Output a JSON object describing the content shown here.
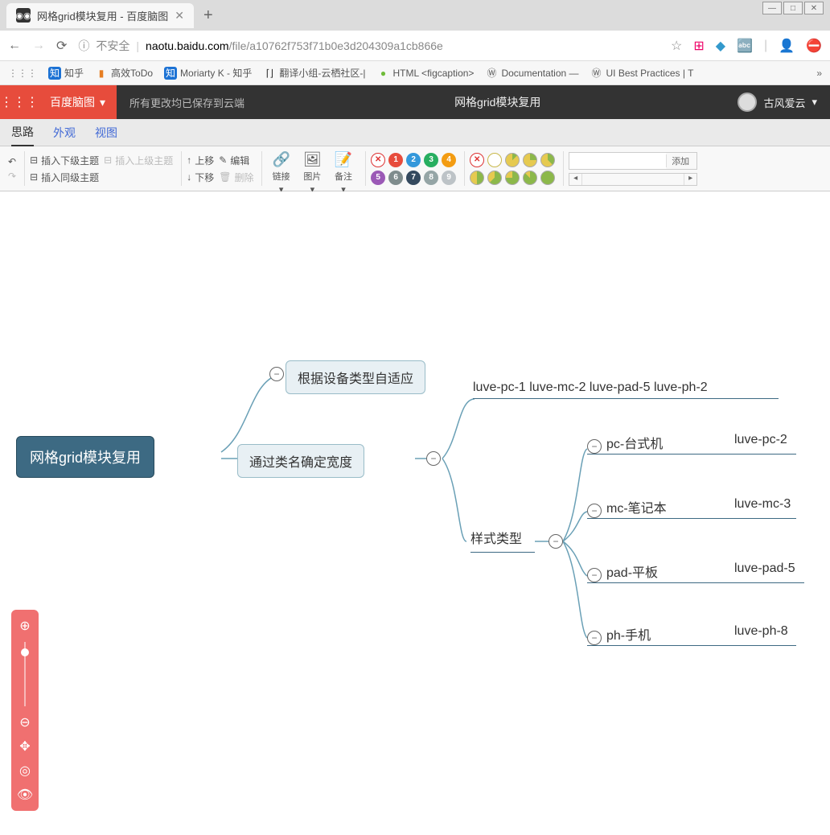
{
  "browser": {
    "tab_title": "网格grid模块复用 - 百度脑图",
    "url_insecure": "不安全",
    "url_domain": "naotu.baidu.com",
    "url_path": "/file/a10762f753f71b0e3d204309a1cb866e"
  },
  "bookmarks": [
    {
      "label": "知乎",
      "icon": "知",
      "color": "#1c72d4"
    },
    {
      "label": "高效ToDo",
      "icon": "■",
      "color": "#e67e22"
    },
    {
      "label": "Moriarty K - 知乎",
      "icon": "知",
      "color": "#1c72d4"
    },
    {
      "label": "翻译小组-云栖社区-|",
      "icon": "[]",
      "color": "#333"
    },
    {
      "label": "HTML <figcaption>",
      "icon": "●",
      "color": "#6fbb3a"
    },
    {
      "label": "Documentation —",
      "icon": "W",
      "color": "#555"
    },
    {
      "label": "UI Best Practices | T",
      "icon": "W",
      "color": "#555"
    }
  ],
  "app": {
    "brand": "百度脑图",
    "save_status": "所有更改均已保存到云端",
    "title": "网格grid模块复用",
    "user": "古风爱云"
  },
  "tabs": {
    "t1": "思路",
    "t2": "外观",
    "t3": "视图"
  },
  "toolbar": {
    "insert_child": "插入下级主题",
    "insert_parent": "插入上级主题",
    "insert_sibling": "插入同级主题",
    "up": "上移",
    "down": "下移",
    "edit": "编辑",
    "delete": "删除",
    "link": "链接",
    "image": "图片",
    "note": "备注",
    "add": "添加",
    "priority": [
      "1",
      "2",
      "3",
      "4",
      "5",
      "6",
      "7",
      "8",
      "9"
    ]
  },
  "mindmap": {
    "root": "网格grid模块复用",
    "n1": "根据设备类型自适应",
    "n2": "通过类名确定宽度",
    "leaf_line": "luve-pc-1 luve-mc-2 luve-pad-5 luve-ph-2",
    "style_type": "样式类型",
    "devices": [
      {
        "label": "pc-台式机",
        "cls": "luve-pc-2"
      },
      {
        "label": "mc-笔记本",
        "cls": "luve-mc-3"
      },
      {
        "label": "pad-平板",
        "cls": "luve-pad-5"
      },
      {
        "label": "ph-手机",
        "cls": "luve-ph-8"
      }
    ]
  }
}
